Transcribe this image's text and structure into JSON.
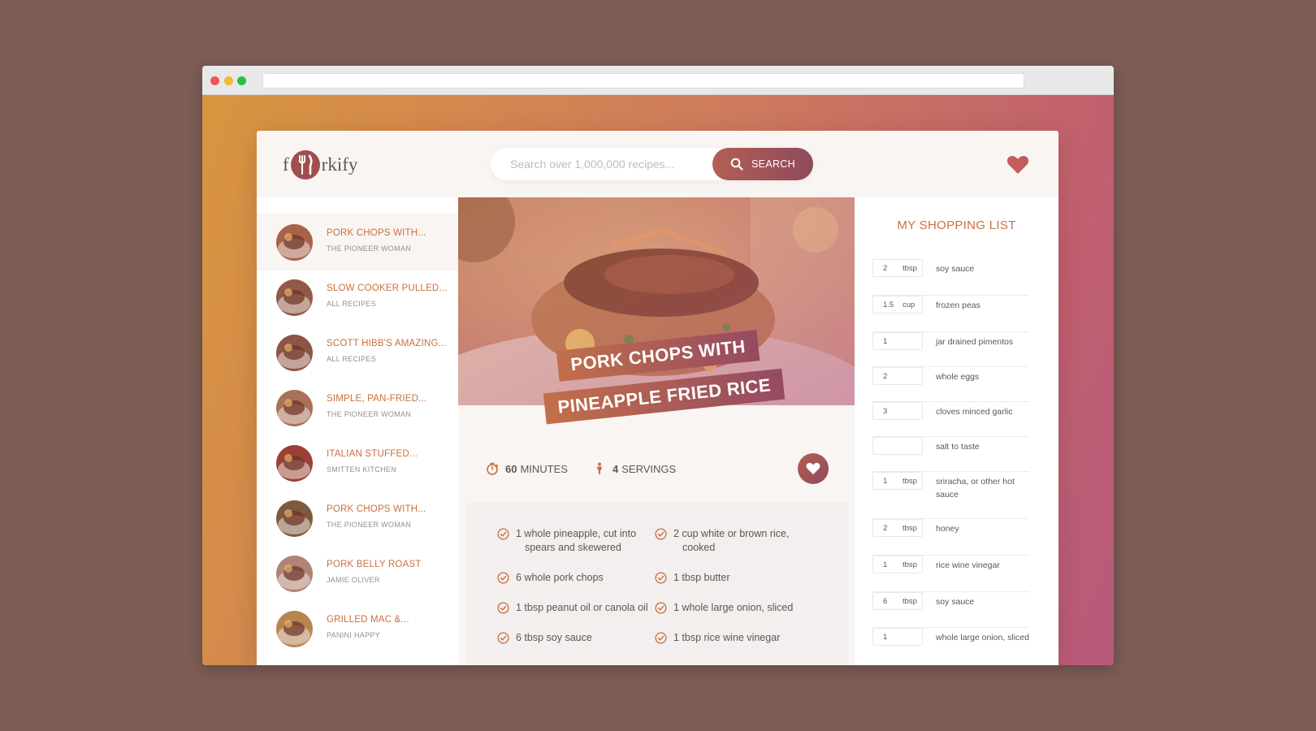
{
  "search": {
    "placeholder": "Search over 1,000,000 recipes...",
    "button_label": "SEARCH"
  },
  "logo": {
    "text_left": "f",
    "text_right": "rkify"
  },
  "results": [
    {
      "title": "PORK CHOPS WITH...",
      "publisher": "THE PIONEER WOMAN",
      "active": true,
      "color": "#a9624a"
    },
    {
      "title": "SLOW COOKER PULLED...",
      "publisher": "ALL RECIPES",
      "color": "#8f5a48"
    },
    {
      "title": "SCOTT HIBB'S AMAZING...",
      "publisher": "ALL RECIPES",
      "color": "#8e5547"
    },
    {
      "title": "SIMPLE, PAN-FRIED...",
      "publisher": "THE PIONEER WOMAN",
      "color": "#a87158"
    },
    {
      "title": "ITALIAN STUFFED...",
      "publisher": "SMITTEN KITCHEN",
      "color": "#9a4036"
    },
    {
      "title": "PORK CHOPS WITH...",
      "publisher": "THE PIONEER WOMAN",
      "color": "#7d5a3f"
    },
    {
      "title": "PORK BELLY ROAST",
      "publisher": "JAMIE OLIVER",
      "color": "#b08377"
    },
    {
      "title": "GRILLED MAC &...",
      "publisher": "PANINI HAPPY",
      "color": "#b88551"
    }
  ],
  "recipe": {
    "title_line1": "PORK CHOPS WITH",
    "title_line2": "PINEAPPLE FRIED RICE",
    "minutes": "60",
    "minutes_label": "MINUTES",
    "servings": "4",
    "servings_label": "SERVINGS",
    "ingredients": [
      {
        "line1": "1 whole pineapple, cut into",
        "line2": "spears and skewered"
      },
      {
        "line1": "2 cup white or brown rice,",
        "line2": "cooked"
      },
      {
        "line1": "6 whole pork chops",
        "line2": ""
      },
      {
        "line1": "1 tbsp butter",
        "line2": ""
      },
      {
        "line1": "1 tbsp peanut oil or canola oil",
        "line2": ""
      },
      {
        "line1": "1 whole large onion, sliced",
        "line2": ""
      },
      {
        "line1": "6 tbsp soy sauce",
        "line2": ""
      },
      {
        "line1": "1 tbsp rice wine vinegar",
        "line2": ""
      }
    ]
  },
  "shopping": {
    "title": "MY SHOPPING LIST",
    "items": [
      {
        "qty": "2",
        "unit": "tbsp",
        "desc": "soy sauce"
      },
      {
        "qty": "1.5",
        "unit": "cup",
        "desc": "frozen peas"
      },
      {
        "qty": "1",
        "unit": "",
        "desc": "jar drained pimentos"
      },
      {
        "qty": "2",
        "unit": "",
        "desc": "whole eggs"
      },
      {
        "qty": "3",
        "unit": "",
        "desc": "cloves minced garlic"
      },
      {
        "qty": "",
        "unit": "",
        "desc": "salt to taste"
      },
      {
        "qty": "1",
        "unit": "tbsp",
        "desc": "sriracha, or other hot sauce"
      },
      {
        "qty": "2",
        "unit": "tbsp",
        "desc": "honey"
      },
      {
        "qty": "1",
        "unit": "tbsp",
        "desc": "rice wine vinegar"
      },
      {
        "qty": "6",
        "unit": "tbsp",
        "desc": "soy sauce"
      },
      {
        "qty": "1",
        "unit": "",
        "desc": "whole large onion, sliced"
      }
    ]
  },
  "colors": {
    "accent": "#c96f3e",
    "brand_dark": "#9f4f4f",
    "text": "#615551",
    "page_bg": "#7d5d56"
  },
  "icons": {
    "timer": "stopwatch-icon",
    "servings": "person-icon",
    "check": "check-circle-icon",
    "heart": "heart-icon",
    "search": "search-icon"
  }
}
